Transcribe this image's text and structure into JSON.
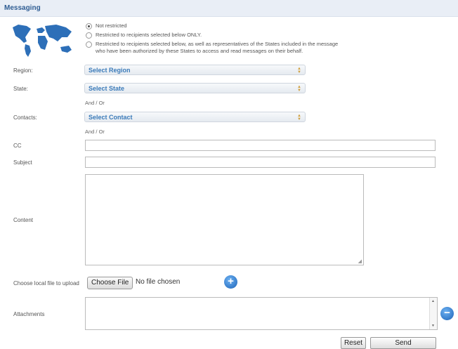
{
  "header": {
    "title": "Messaging"
  },
  "restriction": {
    "options": [
      {
        "label": "Not restricted",
        "selected": true
      },
      {
        "label": "Restricted to recipients selected below ONLY.",
        "selected": false
      },
      {
        "label": "Restricted to recipients selected below, as well as representatives of the States included in the message",
        "label_line2": "who have been authorized by these States to access and read messages on their behalf.",
        "selected": false
      }
    ]
  },
  "fields": {
    "region": {
      "label": "Region:",
      "value": "Select Region"
    },
    "state": {
      "label": "State:",
      "value": "Select State"
    },
    "andor1": "And / Or",
    "contacts": {
      "label": "Contacts:",
      "value": "Select Contact"
    },
    "andor2": "And / Or",
    "cc": {
      "label": "CC",
      "value": ""
    },
    "subject": {
      "label": "Subject",
      "value": ""
    },
    "content": {
      "label": "Content",
      "value": ""
    },
    "upload": {
      "label": "Choose local file to upload",
      "button": "Choose File",
      "status": "No file chosen"
    },
    "attachments": {
      "label": "Attachments"
    }
  },
  "actions": {
    "reset": "Reset",
    "send": "Send"
  },
  "icons": {
    "map": "world-map-icon",
    "add": "plus-circle-icon",
    "remove": "minus-circle-icon"
  },
  "colors": {
    "accent": "#2f5d93",
    "select_text": "#3a7ab9",
    "icon_blue": "#1d64b8"
  }
}
